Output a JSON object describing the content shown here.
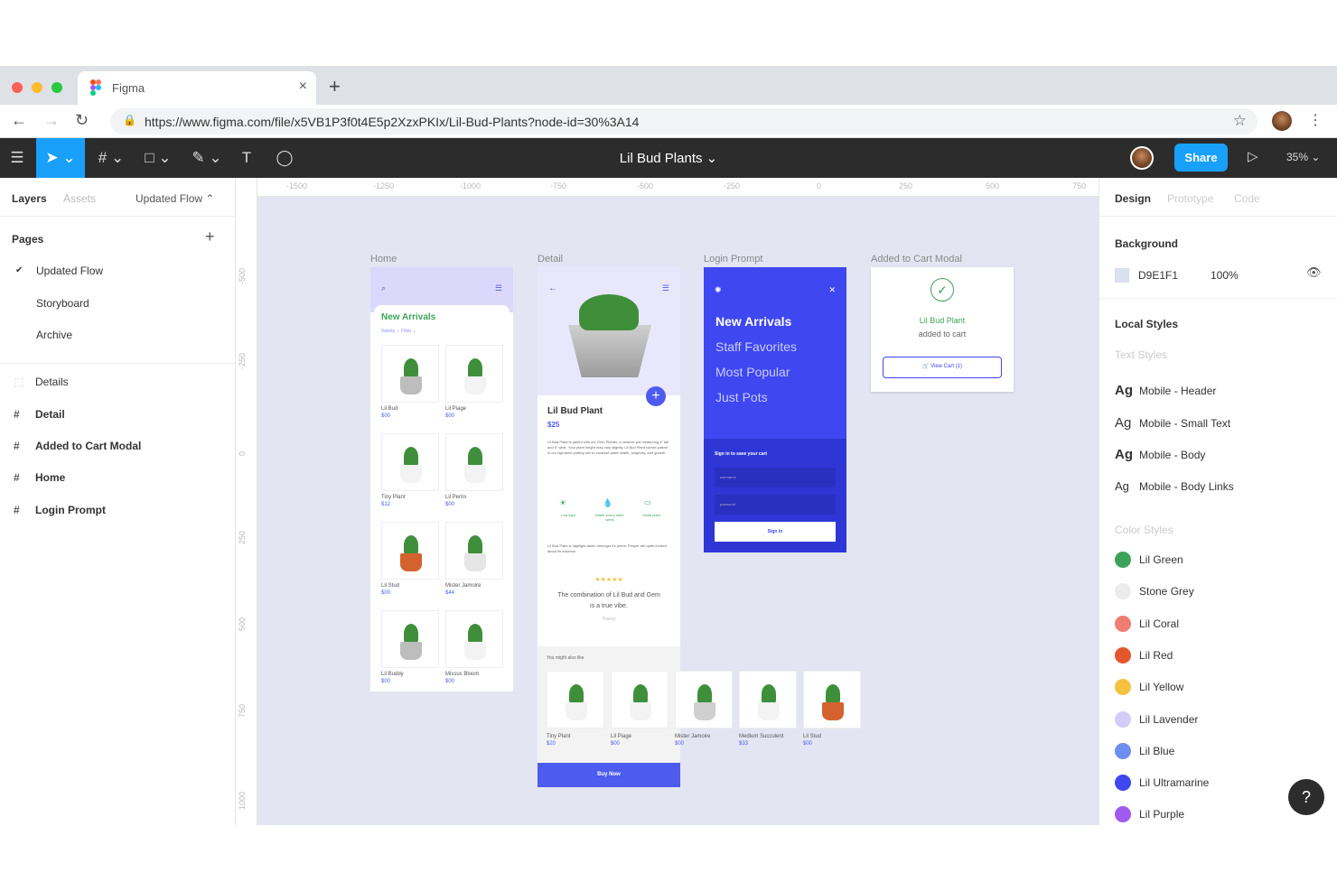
{
  "browser": {
    "tab_title": "Figma",
    "tab_close": "×",
    "new_tab": "+",
    "url": "https://www.figma.com/file/x5VB1P3f0t4E5p2XzxPKIx/Lil-Bud-Plants?node-id=30%3A14",
    "bookmark_icon": "☆",
    "menu_icon": "⋮",
    "back": "←",
    "forward": "→",
    "reload": "↻"
  },
  "toolbar": {
    "doc_title": "Lil Bud Plants ⌄",
    "share": "Share",
    "zoom": "35% ⌄",
    "menu": "☰",
    "move": "➤ ⌄",
    "frame": "# ⌄",
    "shape": "□ ⌄",
    "pen": "✎ ⌄",
    "text": "T",
    "comment": "◯",
    "play": "▷"
  },
  "left_panel": {
    "tabs": [
      "Layers",
      "Assets"
    ],
    "flow": "Updated Flow ⌃",
    "pages_title": "Pages",
    "add": "+",
    "pages": [
      {
        "check": "✔",
        "label": "Updated Flow"
      },
      {
        "check": "",
        "label": "Storyboard"
      },
      {
        "check": "",
        "label": "Archive"
      }
    ],
    "layers": [
      {
        "icon": "⬚",
        "label": "Details"
      },
      {
        "icon": "#",
        "label": "Detail"
      },
      {
        "icon": "#",
        "label": "Added to Cart Modal"
      },
      {
        "icon": "#",
        "label": "Home"
      },
      {
        "icon": "#",
        "label": "Login Prompt"
      }
    ]
  },
  "canvas": {
    "ruler_x": [
      "-1500",
      "-1250",
      "-1000",
      "-750",
      "-500",
      "-250",
      "0",
      "250",
      "500",
      "750"
    ],
    "ruler_y": [
      "-500",
      "-250",
      "0",
      "250",
      "500",
      "750",
      "1000"
    ],
    "frames": {
      "home": "Home",
      "detail": "Detail",
      "login": "Login Prompt",
      "cart": "Added to Cart Modal"
    },
    "home": {
      "heading": "New Arrivals",
      "filters": "Variety ⌄    Filter ⌄",
      "products": [
        {
          "name": "Lil Bud",
          "price": "$00"
        },
        {
          "name": "Lil Piage",
          "price": "$00"
        },
        {
          "name": "Tiny Plant",
          "price": "$12"
        },
        {
          "name": "Lil Perris",
          "price": "$00"
        },
        {
          "name": "Lil Stud",
          "price": "$00"
        },
        {
          "name": "Mister Jamoire",
          "price": "$44"
        },
        {
          "name": "Lil Buddy",
          "price": "$00"
        },
        {
          "name": "Missus Bloom",
          "price": "$00"
        }
      ]
    },
    "detail": {
      "name": "Lil Bud Plant",
      "price": "$25",
      "desc": "Lil Bud Plant is paired with our Gem Planter, a ceramic pot measuring 4\" tall and 5\" wide. Your plant height may vary slightly. Lil Bud Plant comes potted in our signature potting mix to increase plant health, longevity, and growth.",
      "features": [
        "Low light",
        "Water every other week",
        "Small plant"
      ],
      "note": "Lil Bud Plant is highlight taken amongst it's peers. People are quite excited about its essence.",
      "stars": "★★★★★",
      "quote": "The combination of Lil Bud and Gem is a true vibe.",
      "author": "Tracey",
      "also": "You might also like",
      "recs": [
        {
          "name": "Tiny Plant",
          "price": "$20"
        },
        {
          "name": "Lil Piage",
          "price": "$00"
        },
        {
          "name": "Mister Jamoire",
          "price": "$00"
        },
        {
          "name": "Medium Succulent",
          "price": "$33"
        },
        {
          "name": "Lil Stud",
          "price": "$00"
        }
      ],
      "buy": "Buy Now"
    },
    "login": {
      "close": "✕",
      "menu": [
        "New Arrivals",
        "Staff Favorites",
        "Most Popular",
        "Just Pots"
      ],
      "prompt": "Sign in to save your cart",
      "username": "username",
      "password": "password",
      "signin": "Sign in"
    },
    "cart": {
      "check": "✓",
      "title": "Lil Bud Plant",
      "sub": "added to cart",
      "btn": "View Cart (1)"
    }
  },
  "right_panel": {
    "tabs": [
      "Design",
      "Prototype",
      "Code"
    ],
    "background_title": "Background",
    "bg_hex": "D9E1F1",
    "bg_opacity": "100%",
    "eye_icon": "👁",
    "local_styles": "Local Styles",
    "text_styles_title": "Text Styles",
    "text_styles": [
      {
        "ag": "Ag",
        "name": "Mobile - Header"
      },
      {
        "ag": "Ag",
        "name": "Mobile - Small Text"
      },
      {
        "ag": "Ag",
        "name": "Mobile - Body"
      },
      {
        "ag": "Ag",
        "name": "Mobile - Body Links"
      }
    ],
    "color_styles_title": "Color Styles",
    "colors": [
      {
        "name": "Lil Green",
        "hex": "#3ea35a"
      },
      {
        "name": "Stone Grey",
        "hex": "#ececec"
      },
      {
        "name": "Lil Coral",
        "hex": "#ef7d72"
      },
      {
        "name": "Lil Red",
        "hex": "#e4572e"
      },
      {
        "name": "Lil Yellow",
        "hex": "#f5c13f"
      },
      {
        "name": "Lil Lavender",
        "hex": "#d3ccf7"
      },
      {
        "name": "Lil Blue",
        "hex": "#6e8ef0"
      },
      {
        "name": "Lil Ultramarine",
        "hex": "#3f47f0"
      },
      {
        "name": "Lil Purple",
        "hex": "#a05af0"
      }
    ]
  },
  "help": "?",
  "colors": {
    "figma_blue": "#18a0fb",
    "ultramarine": "#3f47f0",
    "lavender": "#dcd8fb",
    "canvas": "#e3e6f2",
    "toolbar": "#2c2c2c"
  }
}
